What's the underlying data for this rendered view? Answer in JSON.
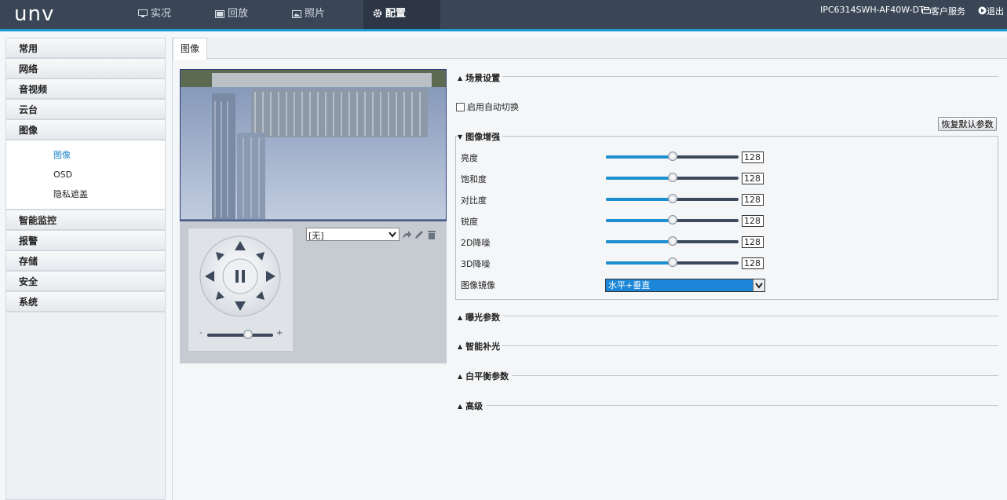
{
  "app": {
    "logo": "unv"
  },
  "nav": {
    "items": [
      {
        "label": "实况",
        "icon": "monitor-icon"
      },
      {
        "label": "回放",
        "icon": "film-icon"
      },
      {
        "label": "照片",
        "icon": "photo-icon"
      },
      {
        "label": "配置",
        "icon": "gear-icon"
      }
    ],
    "active": "配置"
  },
  "header": {
    "device_model": "IPC6314SWH-AF40W-DT",
    "service_label": "客户服务",
    "logout_label": "退出"
  },
  "sidebar": {
    "groups_before": [
      "常用",
      "网络",
      "音视频",
      "云台",
      "图像"
    ],
    "submenu": [
      "图像",
      "OSD",
      "隐私遮盖"
    ],
    "active_sub": "图像",
    "groups_after": [
      "智能监控",
      "报警",
      "存储",
      "安全",
      "系统"
    ]
  },
  "main": {
    "tab_label": "图像",
    "ptz": {
      "preset_value": "[无]",
      "zoom_minus": "-",
      "zoom_plus": "+"
    },
    "scene": {
      "title": "场景设置",
      "auto_switch_label": "启用自动切换",
      "auto_switch_checked": false
    },
    "restore_label": "恢复默认参数",
    "enhance": {
      "title": "图像增强",
      "rows": [
        {
          "label": "亮度",
          "value": "128"
        },
        {
          "label": "饱和度",
          "value": "128"
        },
        {
          "label": "对比度",
          "value": "128"
        },
        {
          "label": "锐度",
          "value": "128"
        },
        {
          "label": "2D降噪",
          "value": "128"
        },
        {
          "label": "3D降噪",
          "value": "128"
        }
      ],
      "mirror_label": "图像镜像",
      "mirror_value": "水平+垂直"
    },
    "sections": [
      "曝光参数",
      "智能补光",
      "白平衡参数",
      "高级"
    ]
  },
  "colors": {
    "accent": "#1d9ad6",
    "topbar": "#3a4656",
    "selected_text": "#1d87c9"
  }
}
